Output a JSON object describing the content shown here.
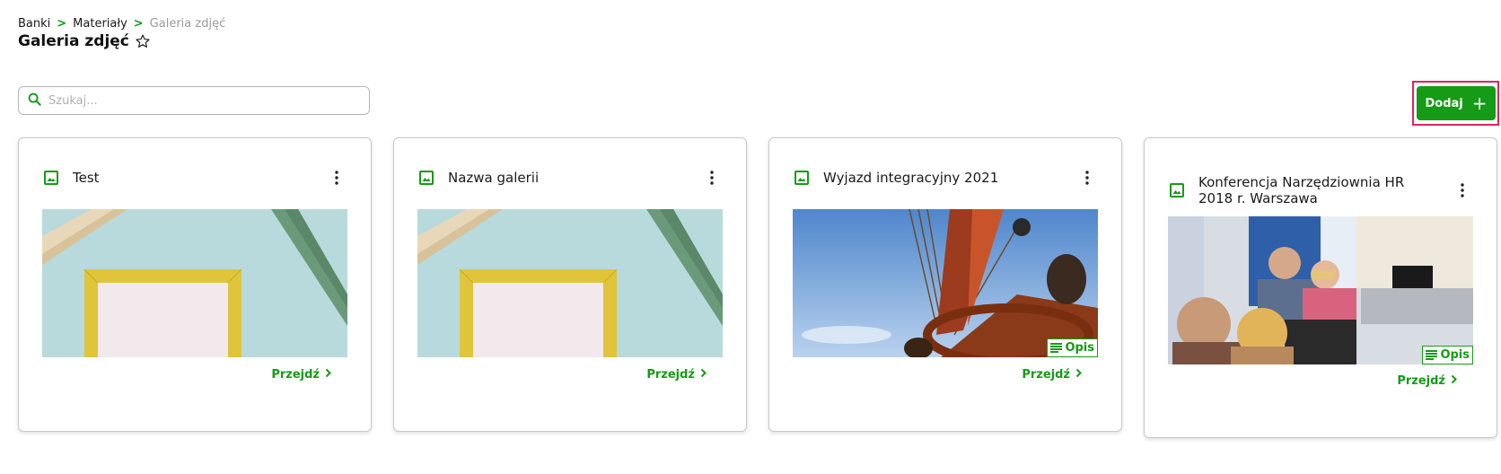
{
  "breadcrumb": {
    "items": [
      "Banki",
      "Materiały"
    ],
    "separator": ">",
    "current": "Galeria zdjęć"
  },
  "page": {
    "title": "Galeria zdjęć"
  },
  "search": {
    "placeholder": "Szukaj..."
  },
  "toolbar": {
    "add_label": "Dodaj"
  },
  "colors": {
    "accent": "#159b16",
    "highlight": "#e0245e"
  },
  "cards": [
    {
      "title": "Test",
      "link": "Przejdź",
      "thumbnail": "picture-frame-photo"
    },
    {
      "title": "Nazwa galerii",
      "link": "Przejdź",
      "thumbnail": "picture-frame-photo"
    },
    {
      "title": "Wyjazd integracyjny 2021",
      "link": "Przejdź",
      "badge": "Opis",
      "thumbnail": "ship-wheel-photo"
    },
    {
      "title": "Konferencja Narzędziownia HR 2018 r. Warszawa",
      "link": "Przejdź",
      "badge": "Opis",
      "thumbnail": "conference-photo"
    }
  ]
}
